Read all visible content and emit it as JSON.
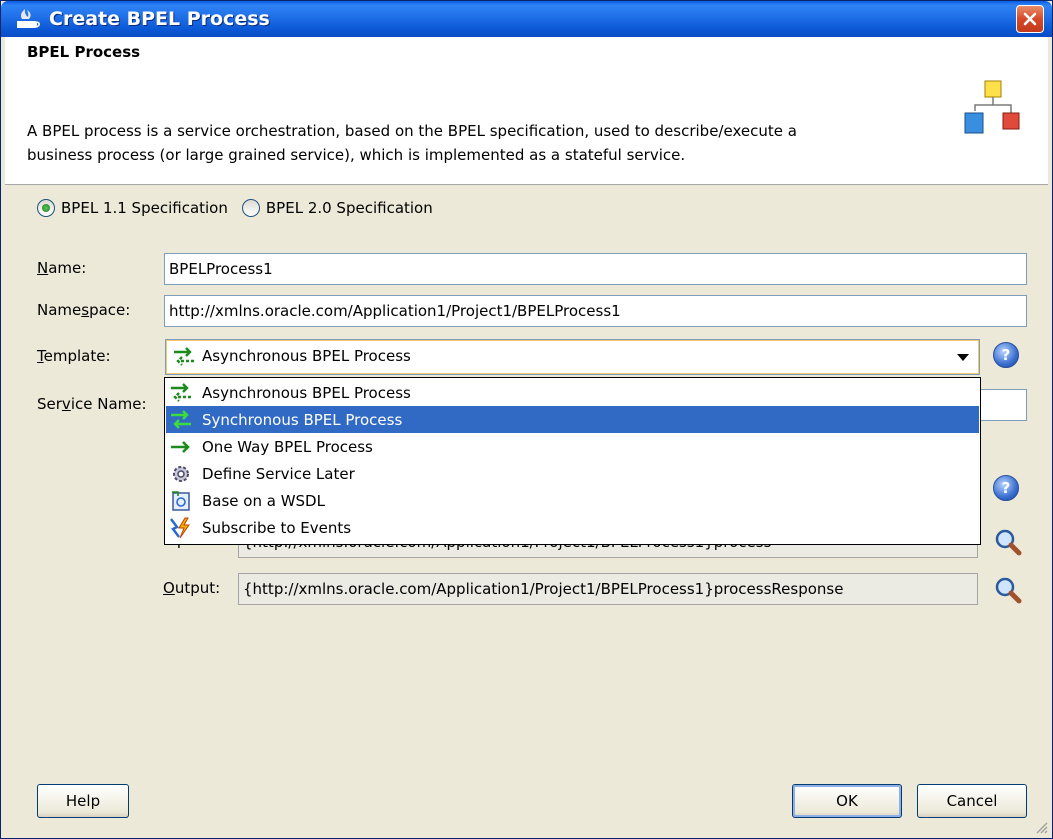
{
  "window": {
    "title": "Create BPEL Process"
  },
  "header": {
    "title": "BPEL Process",
    "description_line1": "A BPEL process is a service orchestration, based on the BPEL specification, used to describe/execute a",
    "description_line2": "business process (or large grained service), which is implemented as a stateful service."
  },
  "spec": {
    "options": [
      "BPEL 1.1 Specification",
      "BPEL 2.0 Specification"
    ],
    "selected": "BPEL 1.1 Specification"
  },
  "form": {
    "name_label_u": "N",
    "name_label_rest": "ame:",
    "name_value": "BPELProcess1",
    "namespace_label_pre": "Name",
    "namespace_label_u": "s",
    "namespace_label_rest": "pace:",
    "namespace_value": "http://xmlns.oracle.com/Application1/Project1/BPELProcess1",
    "template_label_u": "T",
    "template_label_rest": "emplate:",
    "template_value": "Asynchronous BPEL Process",
    "service_label_pre": "Ser",
    "service_label_u": "v",
    "service_label_rest": "ice Name:",
    "input_label": "Input:",
    "input_value": "{http://xmlns.oracle.com/Application1/Project1/BPELProcess1}process",
    "output_label_u": "O",
    "output_label_rest": "utput:",
    "output_value": "{http://xmlns.oracle.com/Application1/Project1/BPELProcess1}processResponse"
  },
  "template_options": [
    {
      "label": "Asynchronous BPEL Process",
      "icon": "async-arrows-icon",
      "selected": false
    },
    {
      "label": "Synchronous BPEL Process",
      "icon": "sync-arrows-icon",
      "selected": true
    },
    {
      "label": "One Way BPEL Process",
      "icon": "one-way-arrow-icon",
      "selected": false
    },
    {
      "label": "Define Service Later",
      "icon": "gear-icon",
      "selected": false
    },
    {
      "label": "Base on a WSDL",
      "icon": "wsdl-icon",
      "selected": false
    },
    {
      "label": "Subscribe to Events",
      "icon": "event-bolt-icon",
      "selected": false
    }
  ],
  "buttons": {
    "help": "Help",
    "ok": "OK",
    "cancel": "Cancel"
  },
  "colors": {
    "titlebar": "#0a5ce0",
    "selection": "#316ac5",
    "dialog_bg": "#ece9d8"
  }
}
